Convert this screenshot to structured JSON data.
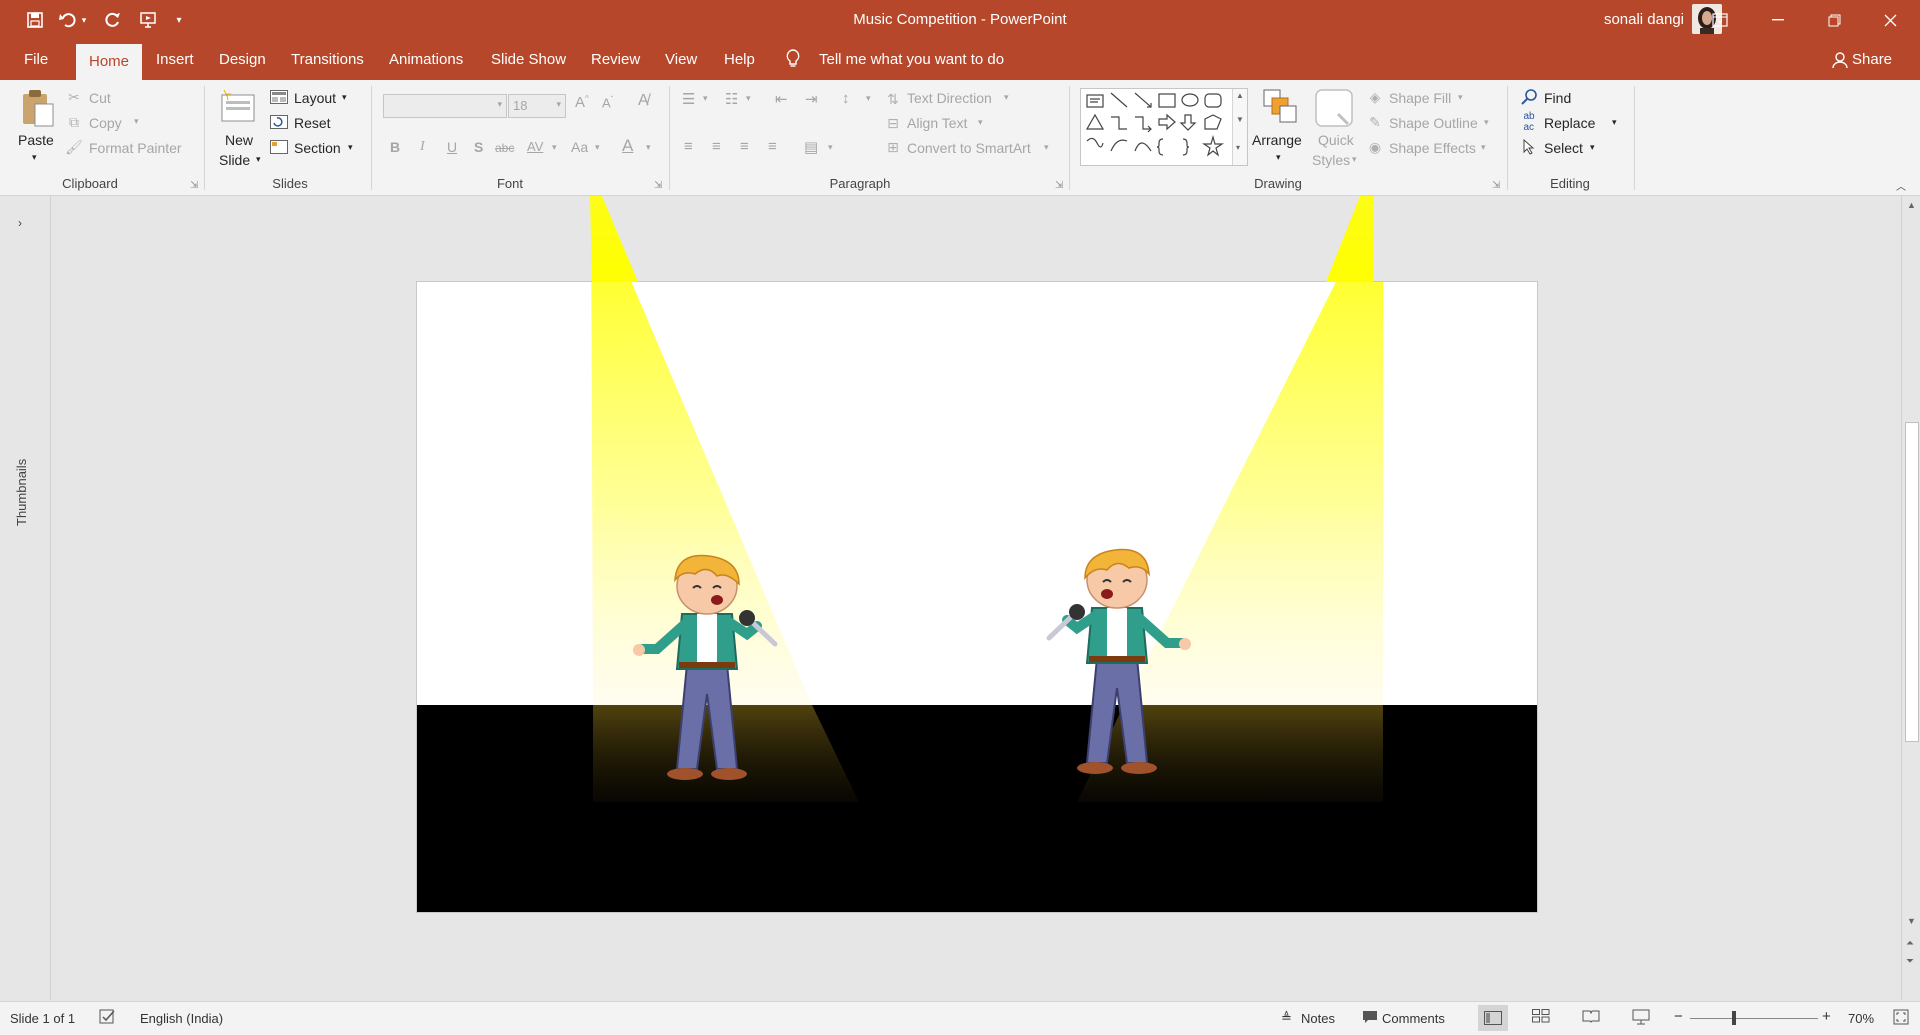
{
  "window": {
    "doc_title": "Music Competition  -  PowerPoint",
    "user_name": "sonali dangi"
  },
  "tabs": {
    "file": "File",
    "home": "Home",
    "insert": "Insert",
    "design": "Design",
    "transitions": "Transitions",
    "animations": "Animations",
    "slide_show": "Slide Show",
    "review": "Review",
    "view": "View",
    "help": "Help",
    "tell_me": "Tell me what you want to do",
    "share": "Share"
  },
  "ribbon": {
    "clipboard": {
      "paste": "Paste",
      "cut": "Cut",
      "copy": "Copy",
      "format_painter": "Format Painter",
      "label": "Clipboard"
    },
    "slides": {
      "new_slide_line1": "New",
      "new_slide_line2": "Slide",
      "layout": "Layout",
      "reset": "Reset",
      "section": "Section",
      "label": "Slides"
    },
    "font": {
      "font_name": "",
      "font_size": "18",
      "bold": "B",
      "italic": "I",
      "underline": "U",
      "shadow": "S",
      "strike": "abc",
      "spacing": "AV",
      "case": "Aa",
      "label": "Font"
    },
    "paragraph": {
      "text_direction": "Text Direction",
      "align_text": "Align Text",
      "convert_smartart": "Convert to SmartArt",
      "label": "Paragraph"
    },
    "drawing": {
      "arrange": "Arrange",
      "quick_styles_1": "Quick",
      "quick_styles_2": "Styles",
      "shape_fill": "Shape Fill",
      "shape_outline": "Shape Outline",
      "shape_effects": "Shape Effects",
      "label": "Drawing"
    },
    "editing": {
      "find": "Find",
      "replace": "Replace",
      "select": "Select",
      "label": "Editing"
    }
  },
  "panes": {
    "thumbnails": "Thumbnails"
  },
  "status": {
    "slide_info": "Slide 1 of 1",
    "language": "English (India)",
    "notes": "Notes",
    "comments": "Comments",
    "zoom": "70%"
  },
  "colors": {
    "accent": "#b7472a",
    "ribbon_bg": "#f3f3f3",
    "canvas_bg": "#e6e6e6",
    "stage_floor": "#000000",
    "spotlight": "#ffff00"
  }
}
